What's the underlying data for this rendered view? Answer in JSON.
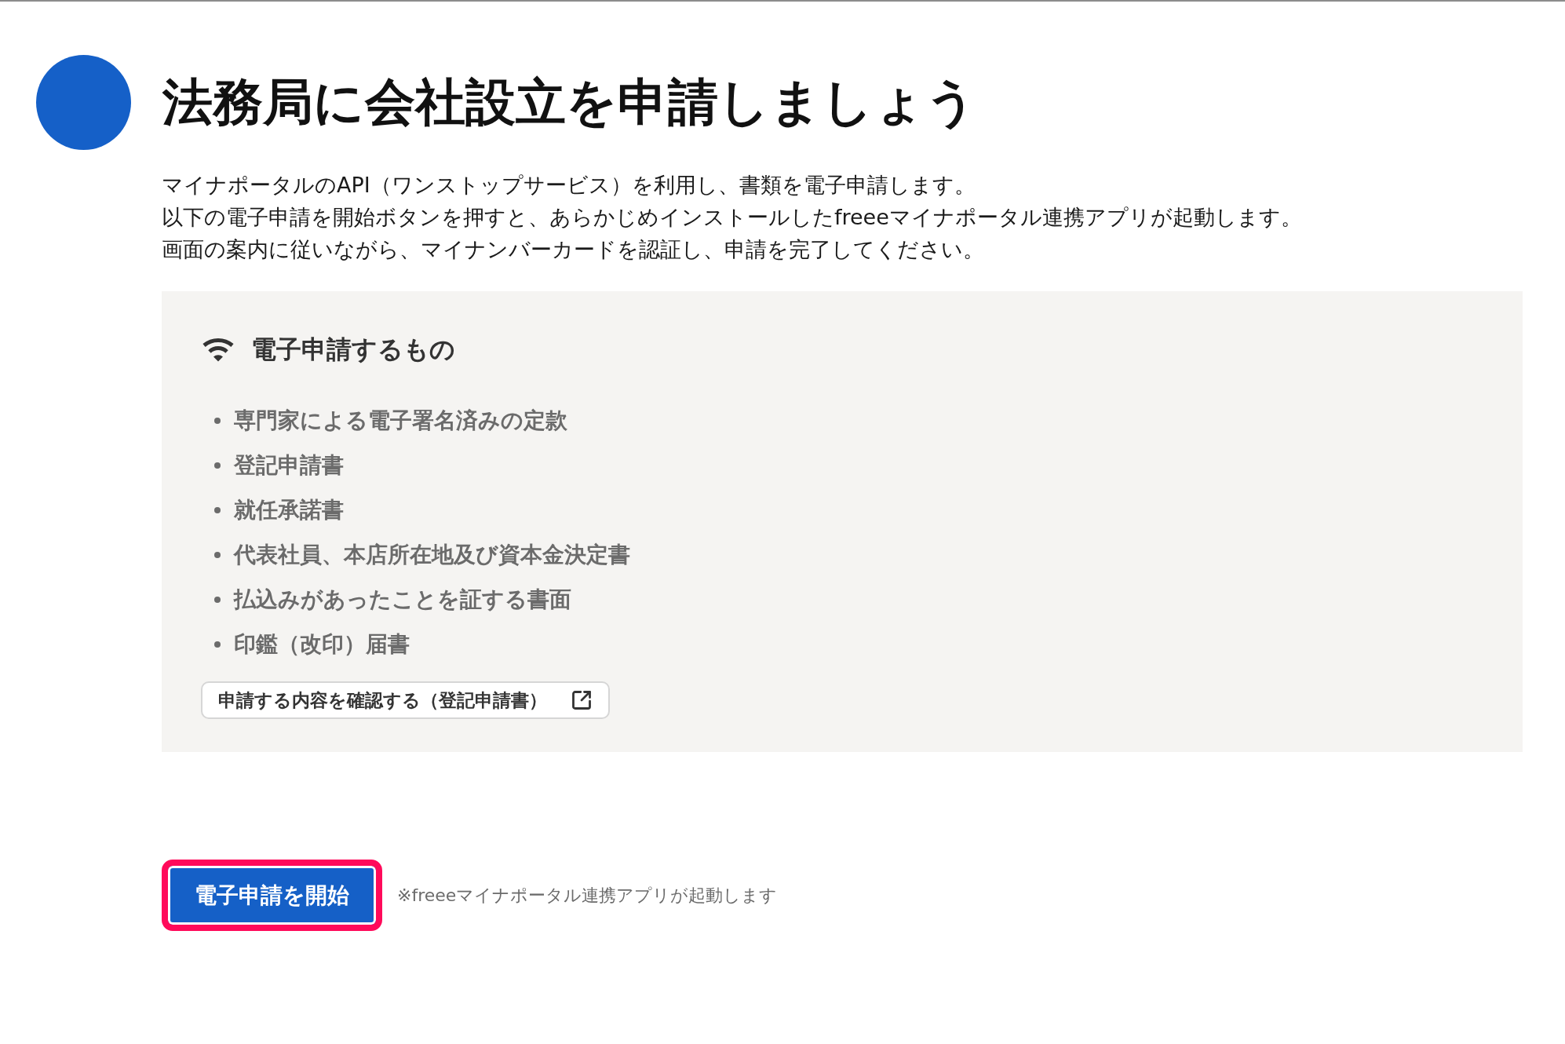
{
  "header": {
    "title": "法務局に会社設立を申請しましょう"
  },
  "description": [
    "マイナポータルのAPI（ワンストップサービス）を利用し、書類を電子申請します。",
    "以下の電子申請を開始ボタンを押すと、あらかじめインストールしたfreeeマイナポータル連携アプリが起動します。",
    "画面の案内に従いながら、マイナンバーカードを認証し、申請を完了してください。"
  ],
  "panel": {
    "heading": "電子申請するもの",
    "items": [
      "専門家による電子署名済みの定款",
      "登記申請書",
      "就任承諾書",
      "代表社員、本店所在地及び資本金決定書",
      "払込みがあったことを証する書面",
      "印鑑（改印）届書"
    ],
    "confirm_button": {
      "label": "申請する内容を確認する（登記申請書）"
    }
  },
  "start": {
    "button": {
      "label": "電子申請を開始",
      "highlighted": true
    },
    "note": "※freeeマイナポータル連携アプリが起動します"
  }
}
